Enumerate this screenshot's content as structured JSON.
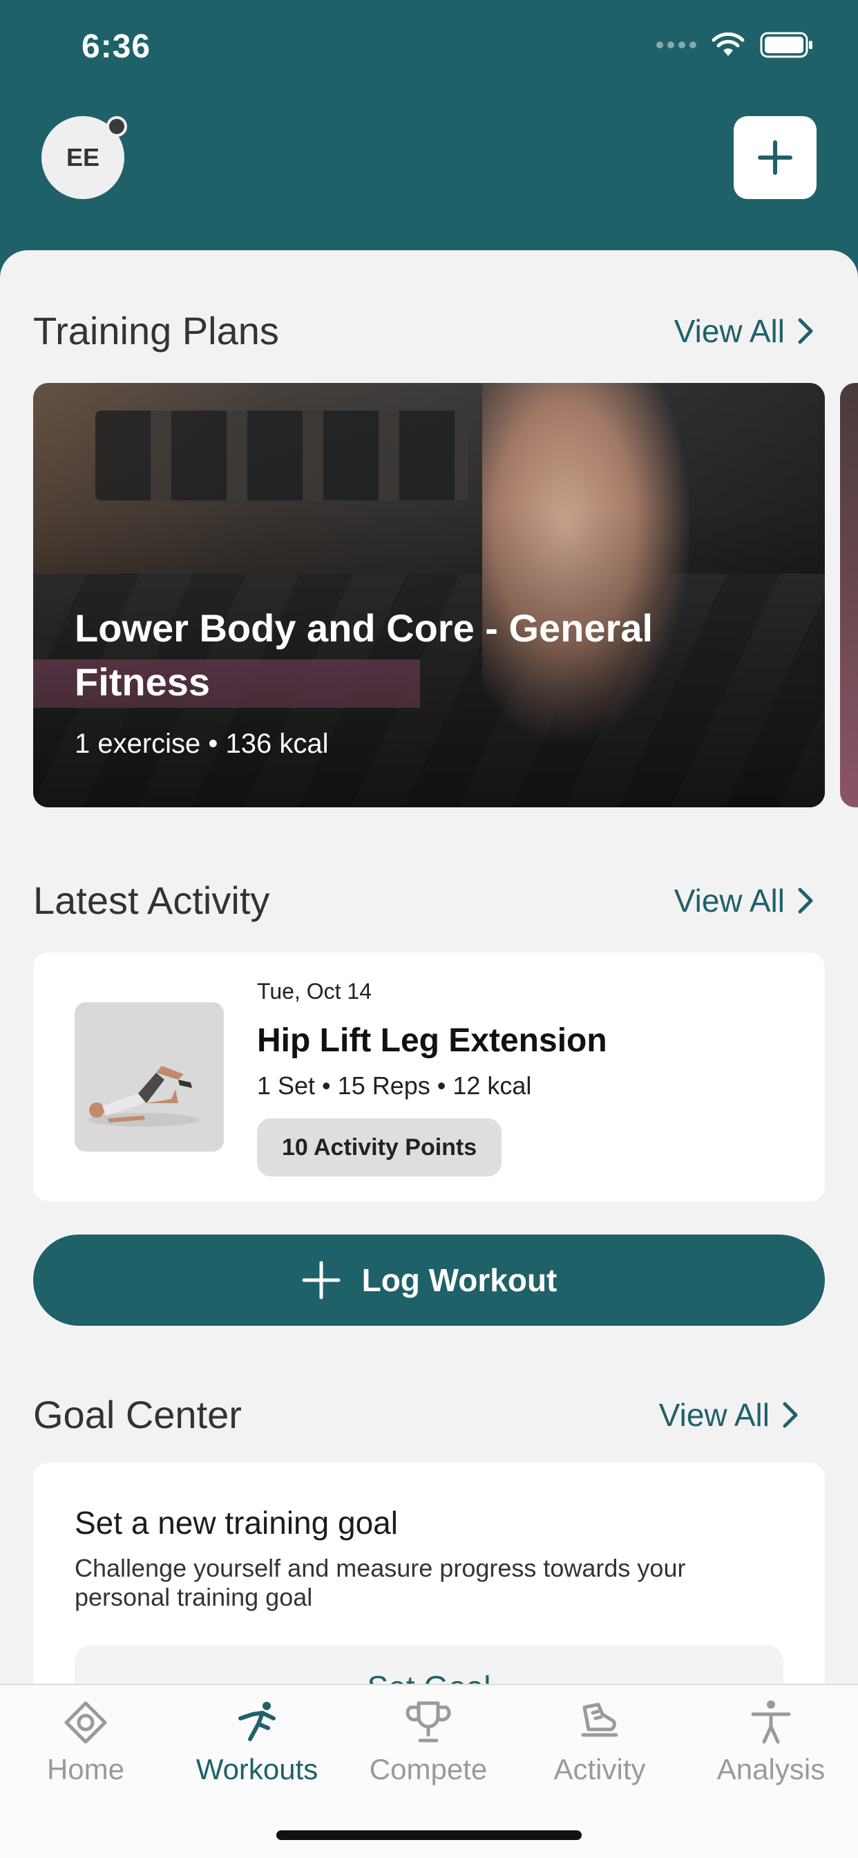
{
  "status_bar": {
    "time": "6:36"
  },
  "header": {
    "avatar_initials": "EE"
  },
  "training_plans": {
    "title": "Training Plans",
    "view_all": "View All",
    "cards": [
      {
        "title": "Lower Body and Core - General Fitness",
        "meta": "1 exercise • 136 kcal"
      }
    ]
  },
  "latest_activity": {
    "title": "Latest Activity",
    "view_all": "View All",
    "item": {
      "date": "Tue, Oct 14",
      "name": "Hip Lift Leg Extension",
      "meta": "1 Set • 15 Reps • 12 kcal",
      "badge": "10 Activity Points"
    }
  },
  "log_workout": {
    "label": "Log Workout"
  },
  "goal_center": {
    "title": "Goal Center",
    "view_all": "View All",
    "card": {
      "title": "Set a new training goal",
      "description": "Challenge yourself and measure progress towards your personal training goal",
      "button": "Set Goal"
    }
  },
  "tabbar": {
    "active": "Workouts",
    "tabs": [
      {
        "label": "Home",
        "icon": "home-icon"
      },
      {
        "label": "Workouts",
        "icon": "workouts-icon"
      },
      {
        "label": "Compete",
        "icon": "trophy-icon"
      },
      {
        "label": "Activity",
        "icon": "activity-icon"
      },
      {
        "label": "Analysis",
        "icon": "analysis-icon"
      }
    ]
  },
  "colors": {
    "brand": "#1f6168",
    "background": "#f2f2f2",
    "inactive_tab": "#9a9a9a"
  }
}
